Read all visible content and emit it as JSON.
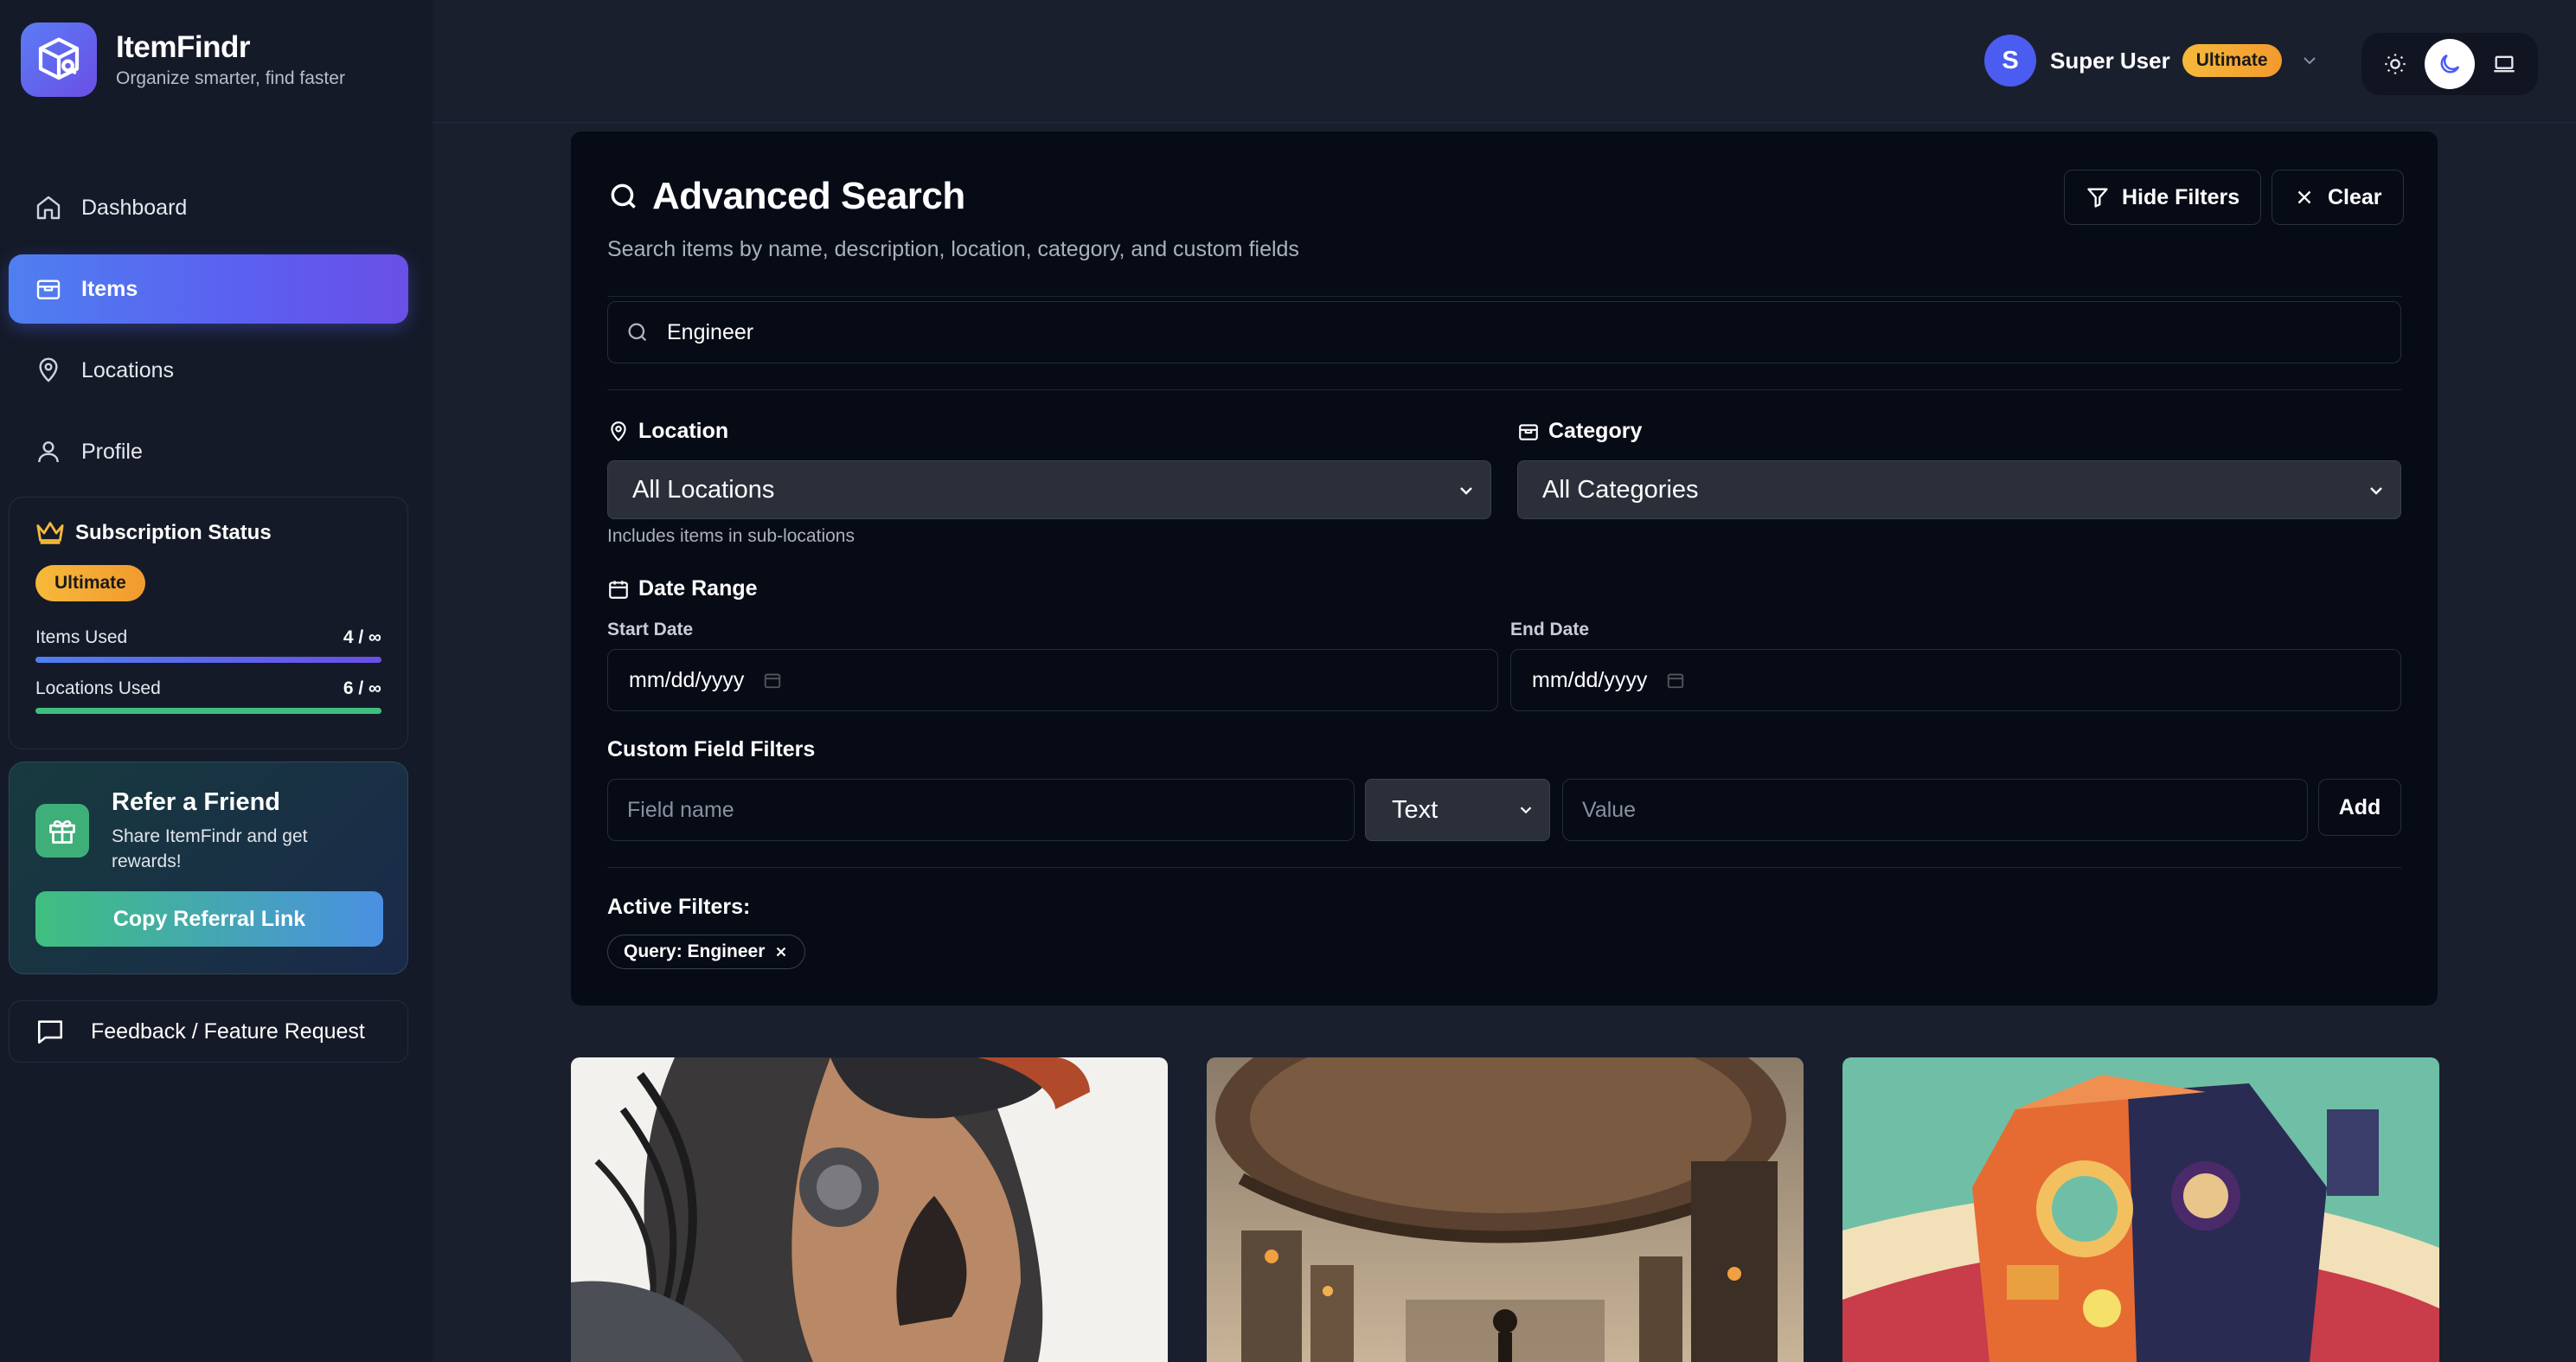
{
  "brand": {
    "name": "ItemFindr",
    "tagline": "Organize smarter, find faster"
  },
  "nav": {
    "items": [
      {
        "label": "Dashboard",
        "icon": "home-icon"
      },
      {
        "label": "Items",
        "icon": "package-icon",
        "active": true
      },
      {
        "label": "Locations",
        "icon": "map-pin-icon"
      },
      {
        "label": "Profile",
        "icon": "user-icon"
      }
    ]
  },
  "subscription": {
    "title": "Subscription Status",
    "plan": "Ultimate",
    "items_label": "Items Used",
    "items_value": "4 / ∞",
    "locations_label": "Locations Used",
    "locations_value": "6 / ∞"
  },
  "referral": {
    "title": "Refer a Friend",
    "subtitle": "Share ItemFindr and get rewards!",
    "button": "Copy Referral Link"
  },
  "feedback": {
    "label": "Feedback / Feature Request"
  },
  "header": {
    "user_initial": "S",
    "user_name": "Super User",
    "user_plan": "Ultimate",
    "theme_active": "dark"
  },
  "search": {
    "title": "Advanced Search",
    "description": "Search items by name, description, location, category, and custom fields",
    "hide_filters": "Hide Filters",
    "clear": "Clear",
    "query": "Engineer",
    "location_label": "Location",
    "location_value": "All Locations",
    "location_hint": "Includes items in sub-locations",
    "category_label": "Category",
    "category_value": "All Categories",
    "date_range_label": "Date Range",
    "start_date_label": "Start Date",
    "start_date_value": "mm/dd/yyyy",
    "end_date_label": "End Date",
    "end_date_value": "mm/dd/yyyy",
    "custom_filters_label": "Custom Field Filters",
    "field_name_placeholder": "Field name",
    "type_value": "Text",
    "value_placeholder": "Value",
    "add_label": "Add",
    "active_filters_label": "Active Filters:",
    "chip_label": "Query: Engineer"
  },
  "colors": {
    "accent": "#5b5ff0",
    "ultimate": "#f6b93b",
    "success": "#3fbf7f",
    "panel": "#070b16"
  }
}
